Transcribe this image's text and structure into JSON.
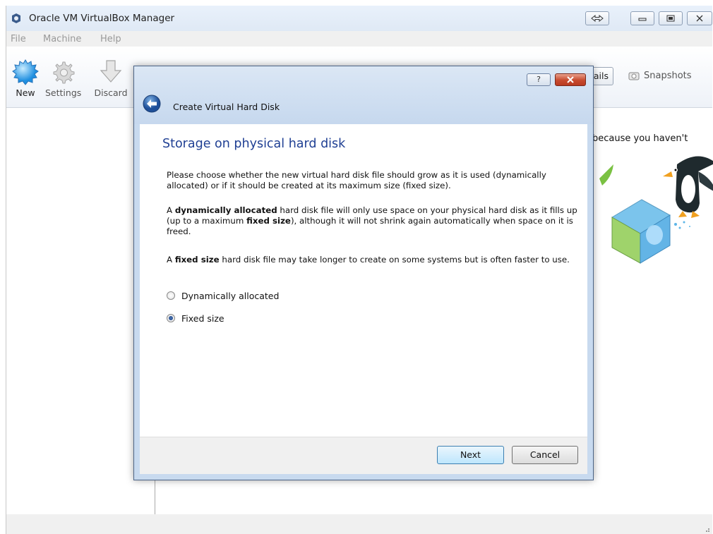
{
  "window": {
    "title": "Oracle VM VirtualBox Manager",
    "menu": [
      "File",
      "Machine",
      "Help"
    ]
  },
  "toolbar": {
    "new_label": "New",
    "settings_label": "Settings",
    "discard_label": "Discard"
  },
  "right_pane": {
    "details_label": "tails",
    "snapshots_label": "Snapshots",
    "welcome_text": "because you haven't"
  },
  "dialog": {
    "help_label": "?",
    "title": "Create Virtual Hard Disk",
    "heading": "Storage on physical hard disk",
    "para1": "Please choose whether the new virtual hard disk file should grow as it is used (dynamically allocated) or if it should be created at its maximum size (fixed size).",
    "para2": {
      "t1": "A ",
      "b1": "dynamically allocated",
      "t2": " hard disk file will only use space on your physical hard disk as it fills up (up to a maximum ",
      "b2": "fixed size",
      "t3": "), although it will not shrink again automatically when space on it is freed."
    },
    "para3": {
      "t1": "A ",
      "b1": "fixed size",
      "t2": " hard disk file may take longer to create on some systems but is often faster to use."
    },
    "options": [
      {
        "label": "Dynamically allocated",
        "checked": false
      },
      {
        "label": "Fixed size",
        "checked": true
      }
    ],
    "next_label": "Next",
    "cancel_label": "Cancel"
  },
  "colors": {
    "heading": "#1f3f93",
    "dialog_frame": "#c8daef",
    "close_button": "#c74a2e"
  }
}
